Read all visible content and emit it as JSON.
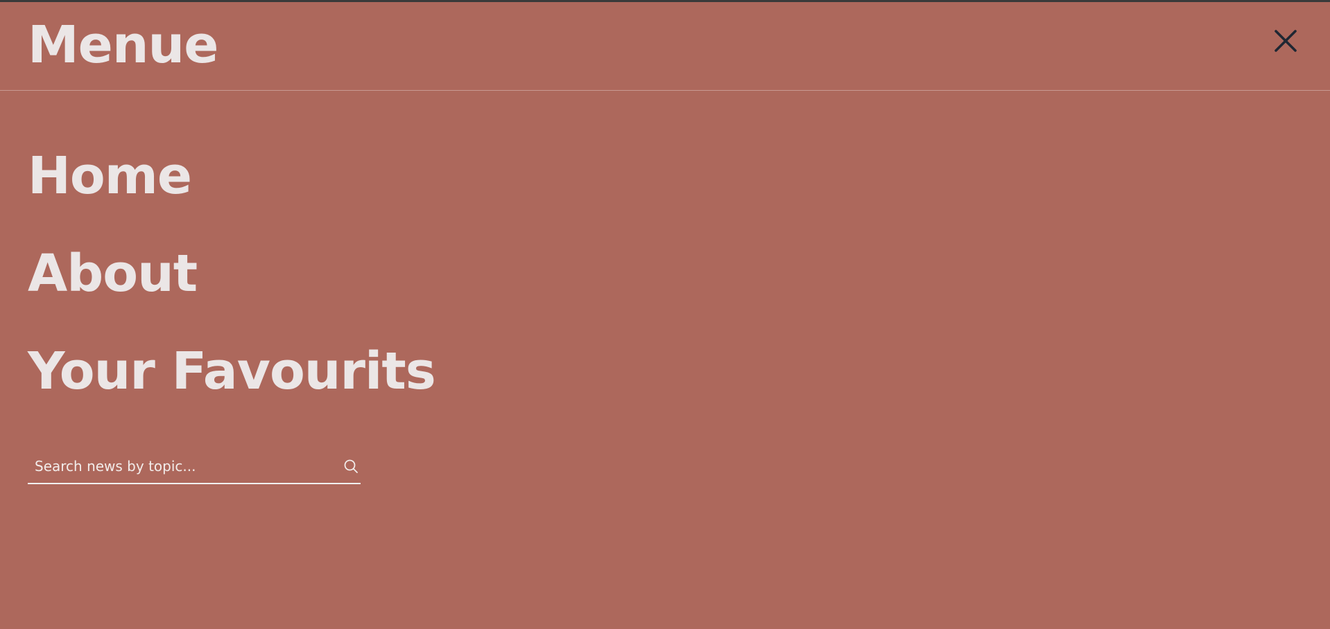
{
  "colors": {
    "background": "#ad685c",
    "text": "#ebe6e6",
    "close_icon": "#1f2733",
    "divider": "#c99a92",
    "top_border": "#3a3a3a"
  },
  "header": {
    "title": "Menue",
    "close_icon": "close-icon"
  },
  "nav": {
    "items": [
      {
        "label": "Home"
      },
      {
        "label": "About"
      },
      {
        "label": "Your Favourits"
      }
    ]
  },
  "search": {
    "placeholder": "Search news by topic...",
    "value": "",
    "icon": "search-icon"
  }
}
